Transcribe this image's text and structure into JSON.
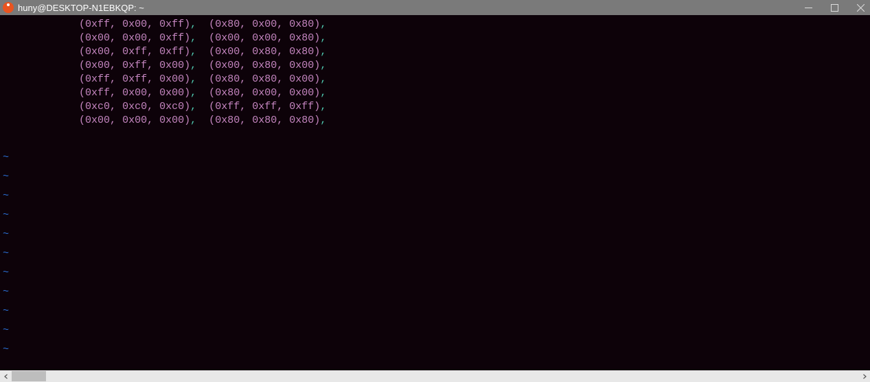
{
  "titlebar": {
    "title": "huny@DESKTOP-N1EBKQP: ~"
  },
  "code": {
    "lines": [
      {
        "t1": [
          "0xff",
          "0x00",
          "0xff"
        ],
        "t2": [
          "0x80",
          "0x00",
          "0x80"
        ]
      },
      {
        "t1": [
          "0x00",
          "0x00",
          "0xff"
        ],
        "t2": [
          "0x00",
          "0x00",
          "0x80"
        ]
      },
      {
        "t1": [
          "0x00",
          "0xff",
          "0xff"
        ],
        "t2": [
          "0x00",
          "0x80",
          "0x80"
        ]
      },
      {
        "t1": [
          "0x00",
          "0xff",
          "0x00"
        ],
        "t2": [
          "0x00",
          "0x80",
          "0x00"
        ]
      },
      {
        "t1": [
          "0xff",
          "0xff",
          "0x00"
        ],
        "t2": [
          "0x80",
          "0x80",
          "0x00"
        ]
      },
      {
        "t1": [
          "0xff",
          "0x00",
          "0x00"
        ],
        "t2": [
          "0x80",
          "0x00",
          "0x00"
        ]
      },
      {
        "t1": [
          "0xc0",
          "0xc0",
          "0xc0"
        ],
        "t2": [
          "0xff",
          "0xff",
          "0xff"
        ]
      },
      {
        "t1": [
          "0x00",
          "0x00",
          "0x00"
        ],
        "t2": [
          "0x80",
          "0x80",
          "0x80"
        ]
      }
    ]
  },
  "tilde_count": 11,
  "tilde_char": "~"
}
